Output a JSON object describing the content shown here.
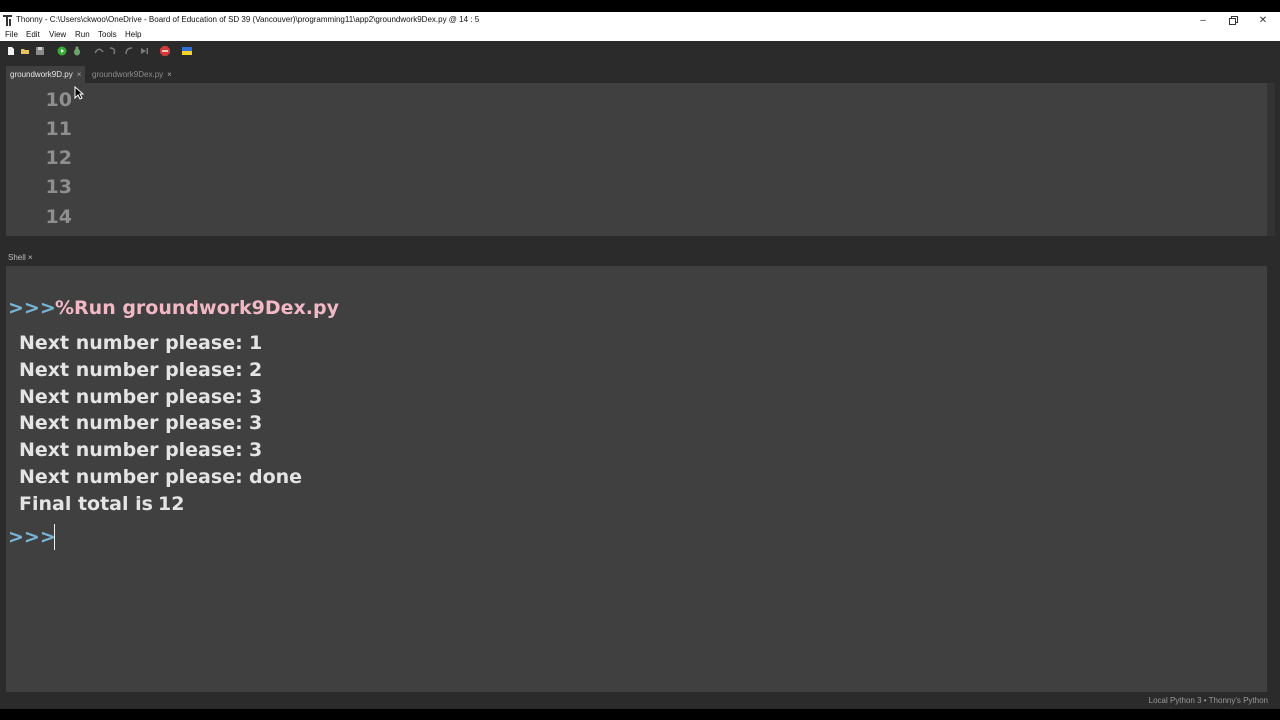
{
  "window": {
    "title": "Thonny  -  C:\\Users\\ckwoo\\OneDrive - Board of Education of SD 39 (Vancouver)\\programming11\\app2\\groundwork9Dex.py  @  14 : 5"
  },
  "menu": [
    "File",
    "Edit",
    "View",
    "Run",
    "Tools",
    "Help"
  ],
  "editor_tabs": [
    {
      "label": "groundwork9D.py",
      "close": "×",
      "active": true
    },
    {
      "label": "groundwork9Dex.py",
      "close": "×",
      "active": false
    }
  ],
  "editor": {
    "line_numbers": [
      "10",
      "11",
      "12",
      "13",
      "14"
    ]
  },
  "shell": {
    "tab_label": "Shell",
    "tab_close": "×",
    "prompt": ">>>",
    "command": "%Run groundwork9Dex.py",
    "output": [
      {
        "label": "Next number please:",
        "value": "1"
      },
      {
        "label": "Next number please:",
        "value": "2"
      },
      {
        "label": "Next number please:",
        "value": "3"
      },
      {
        "label": "Next number please:",
        "value": "3"
      },
      {
        "label": "Next number please:",
        "value": "3"
      },
      {
        "label": "Next number please:",
        "value": "done"
      },
      {
        "label": "Final total is",
        "value": "12"
      }
    ],
    "final_prompt": ">>>"
  },
  "statusbar": {
    "text": "Local Python 3  •  Thonny's Python"
  },
  "colors": {
    "prompt": "#78b6d8",
    "command": "#f2b8c6",
    "output": "#e4e4e4",
    "panel_bg": "#404040",
    "app_bg": "#2b2b2b"
  },
  "toolbar_icons": [
    "new-file-icon",
    "open-file-icon",
    "save-icon",
    "run-icon",
    "debug-icon",
    "step-over-icon",
    "step-into-icon",
    "step-out-icon",
    "resume-icon",
    "stop-icon",
    "ukraine-flag-icon"
  ]
}
